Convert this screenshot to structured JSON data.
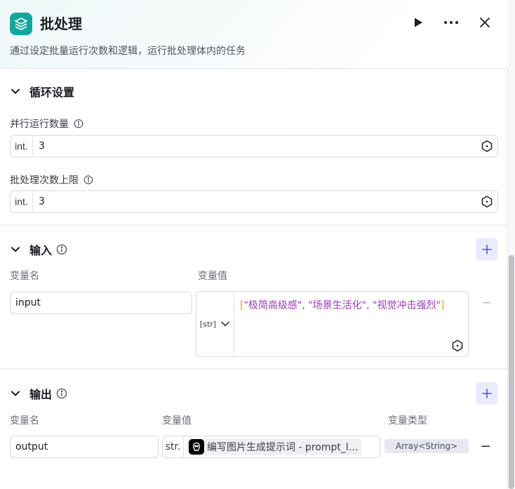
{
  "header": {
    "title": "批处理",
    "description": "通过设定批量运行次数和逻辑，运行批处理体内的任务"
  },
  "loop_settings": {
    "title": "循环设置",
    "concurrency": {
      "label": "并行运行数量",
      "type": "int.",
      "value": "3"
    },
    "batch_limit": {
      "label": "批处理次数上限",
      "type": "int.",
      "value": "3"
    }
  },
  "input": {
    "title": "输入",
    "col_name": "变量名",
    "col_value": "变量值",
    "items": [
      {
        "name": "input",
        "type": "[str]",
        "open_bracket": "[",
        "value_text": "\"极简高级感\", \"场景生活化\", \"视觉冲击强烈\"",
        "close_bracket": "]",
        "minus": "−"
      }
    ]
  },
  "output": {
    "title": "输出",
    "col_name": "变量名",
    "col_value": "变量值",
    "col_type": "变量类型",
    "items": [
      {
        "name": "output",
        "type": "str.",
        "ref_label": "编写图片生成提示词 - prompt_l…",
        "var_type": "Array<String>",
        "minus": "−"
      }
    ]
  },
  "colors": {
    "accent": "#10a7a0",
    "primary_light": "#ecebfd",
    "value_purple": "#9a3ab8",
    "bracket_yellow": "#e5a400"
  }
}
